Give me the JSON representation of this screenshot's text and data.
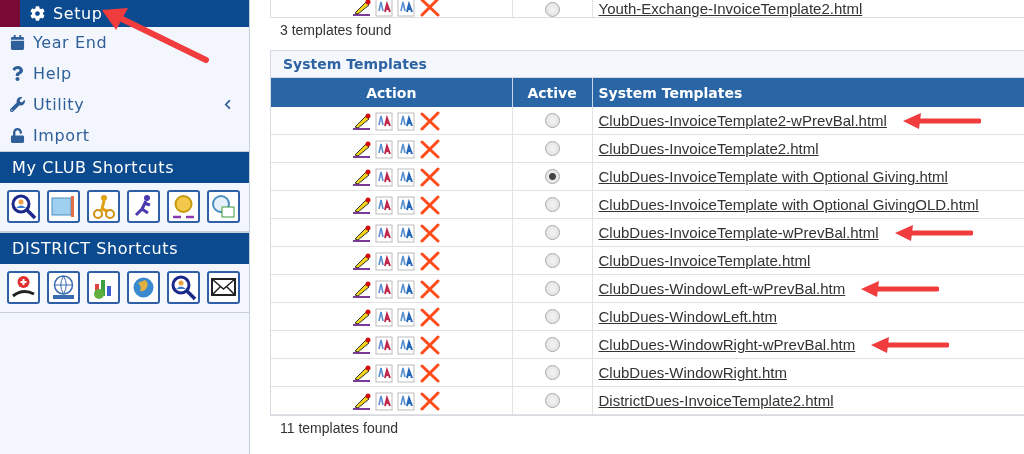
{
  "sidebar": {
    "arrow": true,
    "items": [
      {
        "label": "Setup",
        "selected": true
      },
      {
        "label": "Year End",
        "selected": false
      },
      {
        "label": "Help",
        "selected": false
      },
      {
        "label": "Utility",
        "selected": false,
        "expandable": true
      },
      {
        "label": "Import",
        "selected": false
      }
    ],
    "sections": [
      {
        "title": "My CLUB Shortcuts"
      },
      {
        "title": "DISTRICT Shortcuts"
      }
    ]
  },
  "previous_table": {
    "partial_row": {
      "active": false,
      "file": "Youth-Exchange-InvoiceTemplate2.html"
    },
    "count": "3 templates found"
  },
  "system_templates": {
    "title": "System Templates",
    "columns": [
      "Action",
      "Active",
      "System Templates"
    ],
    "rows": [
      {
        "active": false,
        "file": "ClubDues-InvoiceTemplate2-wPrevBal.html",
        "annotated": true
      },
      {
        "active": false,
        "file": "ClubDues-InvoiceTemplate2.html",
        "annotated": false
      },
      {
        "active": true,
        "file": "ClubDues-InvoiceTemplate with Optional Giving.html",
        "annotated": false
      },
      {
        "active": false,
        "file": "ClubDues-InvoiceTemplate with Optional GivingOLD.html",
        "annotated": false
      },
      {
        "active": false,
        "file": "ClubDues-InvoiceTemplate-wPrevBal.html",
        "annotated": true
      },
      {
        "active": false,
        "file": "ClubDues-InvoiceTemplate.html",
        "annotated": false
      },
      {
        "active": false,
        "file": "ClubDues-WindowLeft-wPrevBal.htm",
        "annotated": true
      },
      {
        "active": false,
        "file": "ClubDues-WindowLeft.htm",
        "annotated": false
      },
      {
        "active": false,
        "file": "ClubDues-WindowRight-wPrevBal.htm",
        "annotated": true
      },
      {
        "active": false,
        "file": "ClubDues-WindowRight.htm",
        "annotated": false
      },
      {
        "active": false,
        "file": "DistrictDues-InvoiceTemplate2.html",
        "annotated": false
      }
    ],
    "count": "11 templates found"
  }
}
